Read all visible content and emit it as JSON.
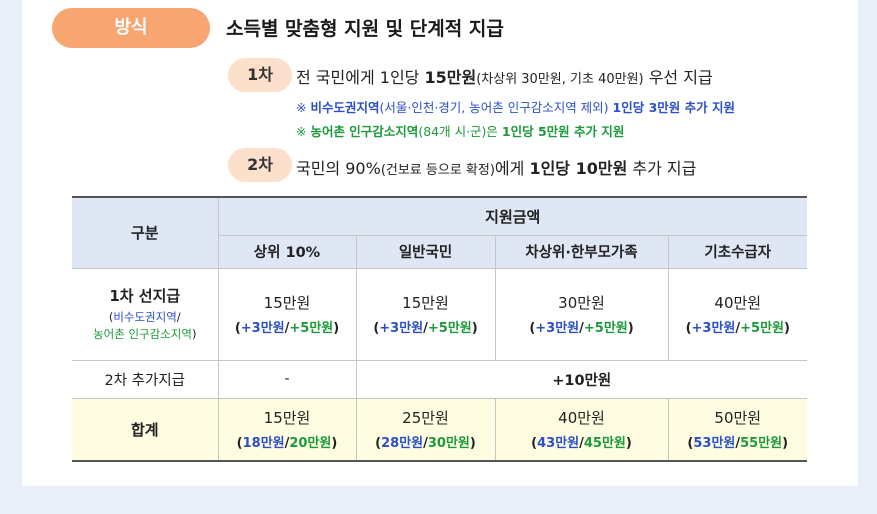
{
  "badge": "방식",
  "heading": "소득별 맞춤형 지원 및 단계적 지급",
  "step1": {
    "pill": "1차",
    "text_a": "전 국민에게 1인당 ",
    "text_b": "15만원",
    "text_c": "(차상위 30만원, 기초 40만원)",
    "text_d": " 우선 지급",
    "note1_a": "※ ",
    "note1_b": "비수도권지역",
    "note1_c": "(서울·인천·경기, 농어촌 인구감소지역 제외) ",
    "note1_d": "1인당 3만원 추가 지원",
    "note2_a": "※ ",
    "note2_b": "농어촌 인구감소지역",
    "note2_c": "(84개 시·군)은 ",
    "note2_d": "1인당 5만원 추가 지원"
  },
  "step2": {
    "pill": "2차",
    "text_a": "국민의 90%",
    "text_b": "(건보료 등으로 확정)",
    "text_c": "에게 ",
    "text_d": "1인당 10만원",
    "text_e": " 추가 지급"
  },
  "table": {
    "col_category": "구분",
    "col_amount": "지원금액",
    "sub_headers": [
      "상위 10%",
      "일반국민",
      "차상위·한부모가족",
      "기초수급자"
    ],
    "row1": {
      "label": "1차 선지급",
      "label_sub_open": "(",
      "label_sub_blue": "비수도권지역",
      "label_sub_slash": "/",
      "label_sub_green": "농어촌 인구감소지역",
      "label_sub_close": ")",
      "cells": [
        {
          "main": "15만원",
          "open": "(",
          "blue": "+3만원",
          "slash": "/",
          "green": "+5만원",
          "close": ")"
        },
        {
          "main": "15만원",
          "open": "(",
          "blue": "+3만원",
          "slash": "/",
          "green": "+5만원",
          "close": ")"
        },
        {
          "main": "30만원",
          "open": "(",
          "blue": "+3만원",
          "slash": "/",
          "green": "+5만원",
          "close": ")"
        },
        {
          "main": "40만원",
          "open": "(",
          "blue": "+3만원",
          "slash": "/",
          "green": "+5만원",
          "close": ")"
        }
      ]
    },
    "row2": {
      "label": "2차 추가지급",
      "first": "-",
      "merged": "+10만원"
    },
    "row3": {
      "label": "합계",
      "cells": [
        {
          "main": "15만원",
          "open": "(",
          "blue": "18만원",
          "slash": "/",
          "green": "20만원",
          "close": ")"
        },
        {
          "main": "25만원",
          "open": "(",
          "blue": "28만원",
          "slash": "/",
          "green": "30만원",
          "close": ")"
        },
        {
          "main": "40만원",
          "open": "(",
          "blue": "43만원",
          "slash": "/",
          "green": "45만원",
          "close": ")"
        },
        {
          "main": "50만원",
          "open": "(",
          "blue": "53만원",
          "slash": "/",
          "green": "55만원",
          "close": ")"
        }
      ]
    }
  }
}
